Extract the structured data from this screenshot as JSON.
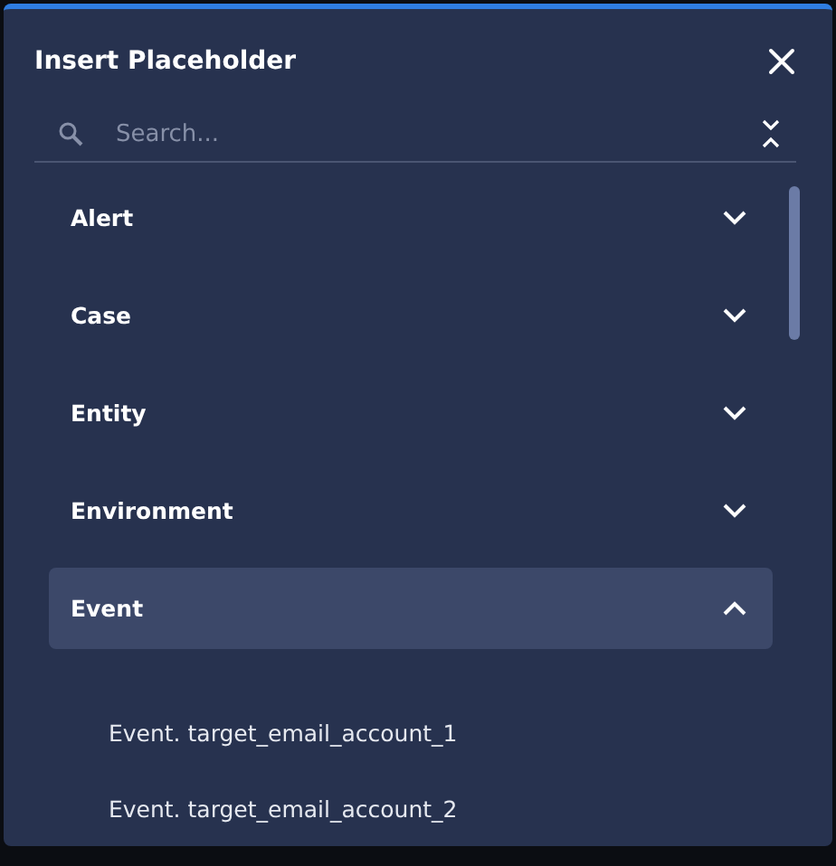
{
  "dialog": {
    "title": "Insert Placeholder"
  },
  "search": {
    "placeholder": "Search..."
  },
  "groups": [
    {
      "label": "Alert",
      "expanded": false
    },
    {
      "label": "Case",
      "expanded": false
    },
    {
      "label": "Entity",
      "expanded": false
    },
    {
      "label": "Environment",
      "expanded": false
    },
    {
      "label": "Event",
      "expanded": true,
      "children": [
        {
          "label": "Event. target_email_account_1"
        },
        {
          "label": "Event. target_email_account_2"
        }
      ]
    }
  ]
}
